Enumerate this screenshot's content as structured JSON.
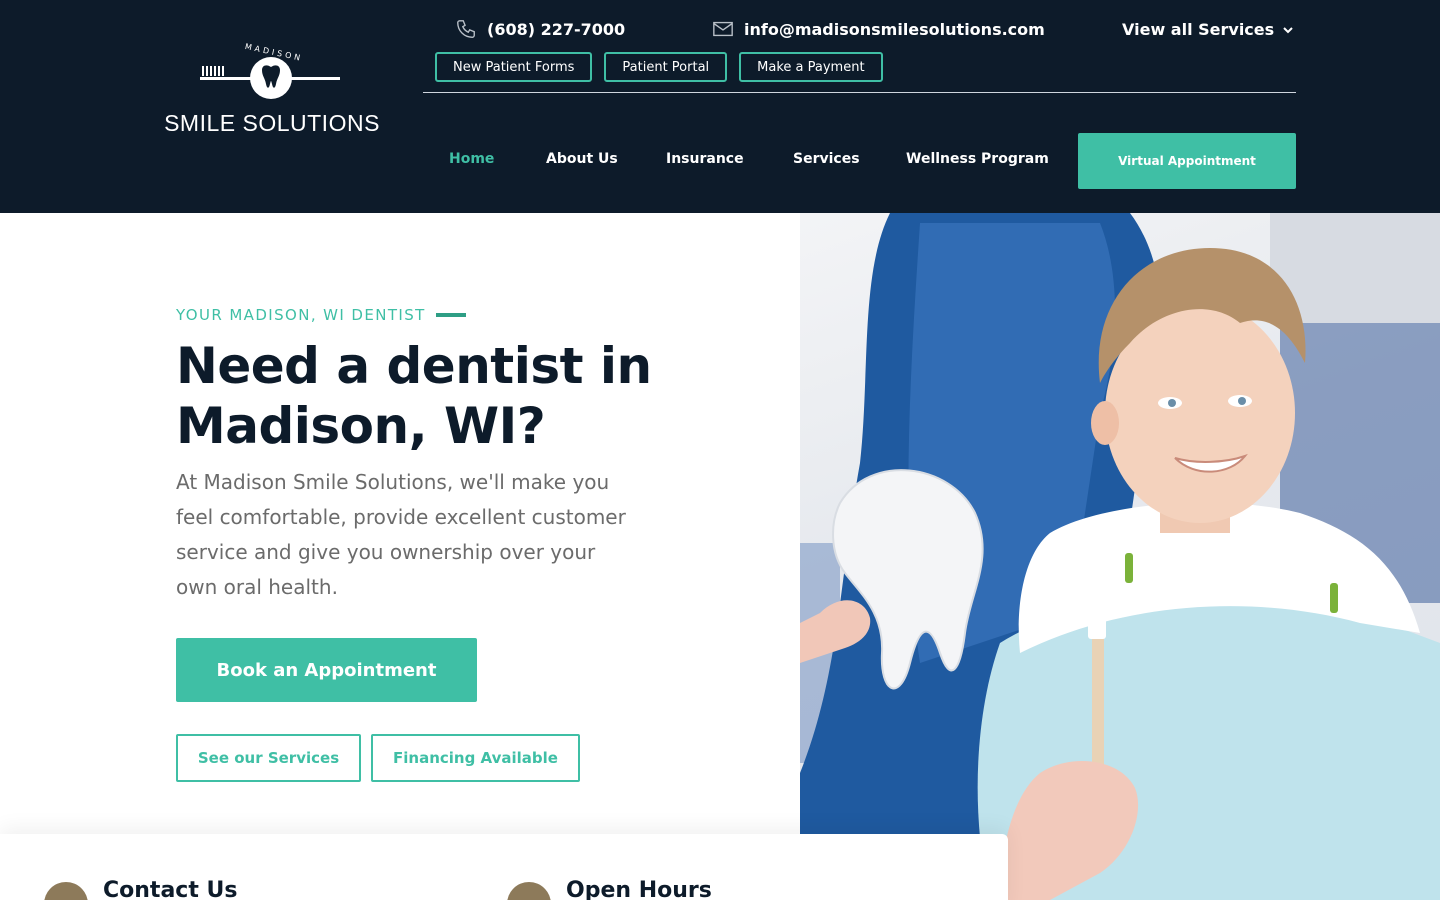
{
  "brand": {
    "top_word": "MADISON",
    "name": "SMILE SOLUTIONS"
  },
  "contact": {
    "phone": "(608) 227-7000",
    "email": "info@madisonsmilesolutions.com"
  },
  "services_dropdown": {
    "label": "View all Services"
  },
  "quick_links": [
    {
      "label": "New Patient Forms"
    },
    {
      "label": "Patient Portal"
    },
    {
      "label": "Make a Payment"
    }
  ],
  "nav": {
    "items": [
      {
        "label": "Home",
        "active": true
      },
      {
        "label": "About Us"
      },
      {
        "label": "Insurance"
      },
      {
        "label": "Services"
      },
      {
        "label": "Wellness Program"
      }
    ],
    "cta": "Virtual Appointment"
  },
  "hero": {
    "eyebrow": "YOUR MADISON, WI DENTIST",
    "title": "Need a dentist in Madison, WI?",
    "text": "At Madison Smile Solutions, we'll make you feel comfortable, provide excellent customer service and give you ownership over your own oral health.",
    "primary_button": "Book an Appointment",
    "secondary_buttons": [
      {
        "label": "See our Services"
      },
      {
        "label": "Financing Available"
      }
    ]
  },
  "info_card": {
    "contact_title": "Contact Us",
    "hours_title": "Open Hours"
  },
  "colors": {
    "navy": "#0d1b2a",
    "teal": "#3fbfa5",
    "gold": "#8d7a5a"
  }
}
